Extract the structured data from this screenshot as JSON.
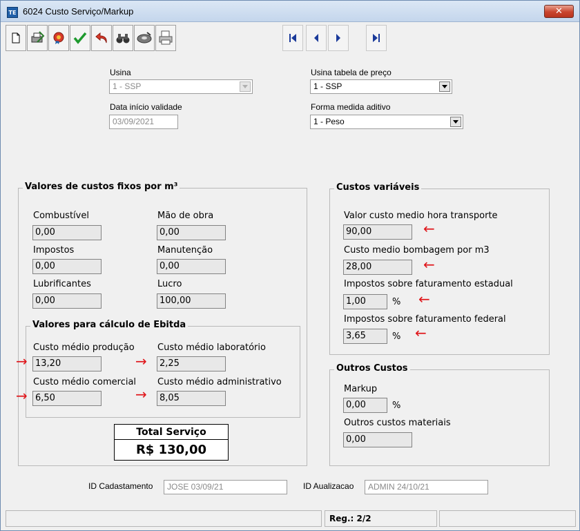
{
  "window": {
    "title": "6024 Custo Serviço/Markup",
    "close_label": "✕"
  },
  "toolbar": {
    "buttons": [
      "new-document-icon",
      "print-setup-icon",
      "ribbon-icon",
      "confirm-icon",
      "undo-icon",
      "binoculars-icon",
      "disk-icon",
      "printer-icon"
    ],
    "nav": [
      "first-record-icon",
      "previous-record-icon",
      "next-record-icon",
      "last-record-icon"
    ]
  },
  "header": {
    "usina_label": "Usina",
    "usina_value": "1 - SSP",
    "usina_tabela_label": "Usina tabela de preço",
    "usina_tabela_value": "1 - SSP",
    "data_inicio_label": "Data início validade",
    "data_inicio_value": "03/09/2021",
    "forma_medida_label": "Forma medida aditivo",
    "forma_medida_value": "1 - Peso"
  },
  "fixos": {
    "title": "Valores de custos fixos por m³",
    "combustivel_label": "Combustível",
    "combustivel_value": "0,00",
    "mao_obra_label": "Mão de obra",
    "mao_obra_value": "0,00",
    "impostos_label": "Impostos",
    "impostos_value": "0,00",
    "manutencao_label": "Manutenção",
    "manutencao_value": "0,00",
    "lubrificantes_label": "Lubrificantes",
    "lubrificantes_value": "0,00",
    "lucro_label": "Lucro",
    "lucro_value": "100,00"
  },
  "ebitda": {
    "title": "Valores para cálculo de Ebitda",
    "producao_label": "Custo médio produção",
    "producao_value": "13,20",
    "laboratorio_label": "Custo médio laboratório",
    "laboratorio_value": "2,25",
    "comercial_label": "Custo médio comercial",
    "comercial_value": "6,50",
    "administrativo_label": "Custo médio administrativo",
    "administrativo_value": "8,05"
  },
  "total": {
    "title": "Total Serviço",
    "value": "R$ 130,00"
  },
  "variaveis": {
    "title": "Custos variáveis",
    "hora_transporte_label": "Valor custo medio hora transporte",
    "hora_transporte_value": "90,00",
    "bombagem_label": "Custo medio bombagem por m3",
    "bombagem_value": "28,00",
    "estadual_label": "Impostos sobre faturamento estadual",
    "estadual_value": "1,00",
    "federal_label": "Impostos sobre faturamento federal",
    "federal_value": "3,65",
    "pct_symbol": "%"
  },
  "outros": {
    "title": "Outros Custos",
    "markup_label": "Markup",
    "markup_value": "0,00",
    "materiais_label": "Outros custos materiais",
    "materiais_value": "0,00",
    "pct_symbol": "%"
  },
  "footer": {
    "id_cadastro_label": "ID Cadastamento",
    "id_cadastro_value": "JOSE 03/09/21",
    "id_atualizacao_label": "ID Aualizacao",
    "id_atualizacao_value": "ADMIN 24/10/21"
  },
  "status": {
    "reg": "Reg.: 2/2"
  },
  "colors": {
    "annotation_arrow": "#e0161b",
    "titlebar": "#c4d6ec"
  }
}
